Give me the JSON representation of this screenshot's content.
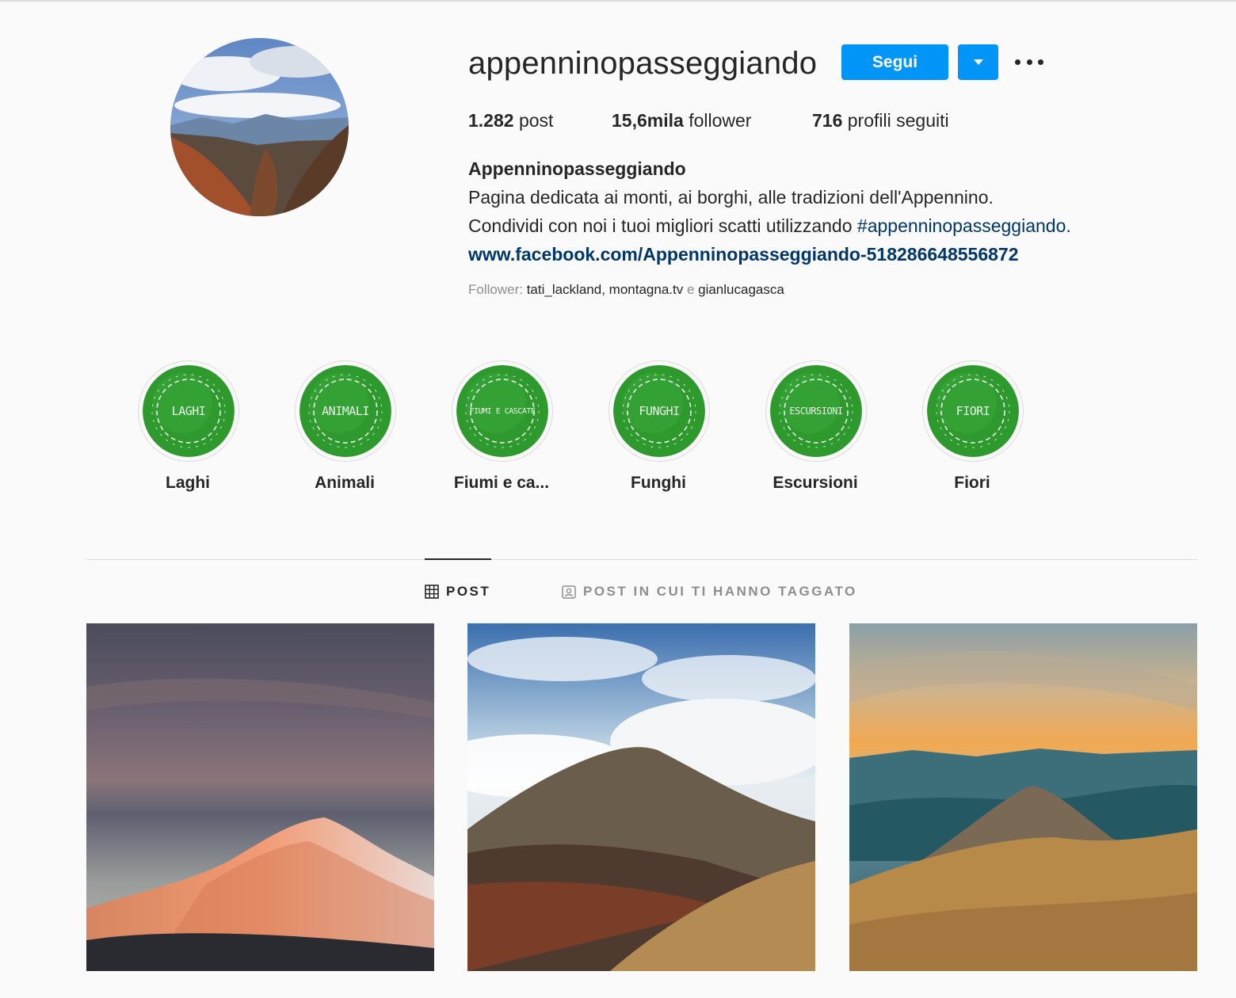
{
  "profile": {
    "username": "appenninopasseggiando",
    "follow_label": "Segui",
    "stats": [
      {
        "count": "1.282",
        "label": "post"
      },
      {
        "count": "15,6mila",
        "label": "follower"
      },
      {
        "count": "716",
        "label": "profili seguiti"
      }
    ],
    "bio": {
      "name": "Appenninopasseggiando",
      "line1": "Pagina dedicata ai monti, ai borghi, alle tradizioni dell'Appennino.",
      "line2_prefix": "Condividi con noi i tuoi migliori scatti utilizzando ",
      "hashtag": "#appenninopasseggiando",
      "line2_suffix": ".",
      "link": "www.facebook.com/Appenninopasseggiando-518286648556872"
    },
    "followed_by": {
      "prefix": "Follower: ",
      "users": [
        "tati_lackland",
        "montagna.tv",
        "gianlucagasca"
      ],
      "sep": ", ",
      "conj": " e "
    }
  },
  "highlights": [
    {
      "label": "Laghi",
      "cover_text": "LAGHI"
    },
    {
      "label": "Animali",
      "cover_text": "ANIMALI"
    },
    {
      "label": "Fiumi e ca...",
      "cover_text": "FIUMI E CASCATE"
    },
    {
      "label": "Funghi",
      "cover_text": "FUNGHI"
    },
    {
      "label": "Escursioni",
      "cover_text": "ESCURSIONI"
    },
    {
      "label": "Fiori",
      "cover_text": "FIORI"
    }
  ],
  "tabs": [
    {
      "label": "POST",
      "icon": "grid-icon",
      "active": true
    },
    {
      "label": "POST IN CUI TI HANNO TAGGATO",
      "icon": "tagged-icon",
      "active": false
    }
  ],
  "colors": {
    "accent": "#0095f6",
    "link": "#00376b",
    "highlight_green": "#2e9a2e"
  }
}
